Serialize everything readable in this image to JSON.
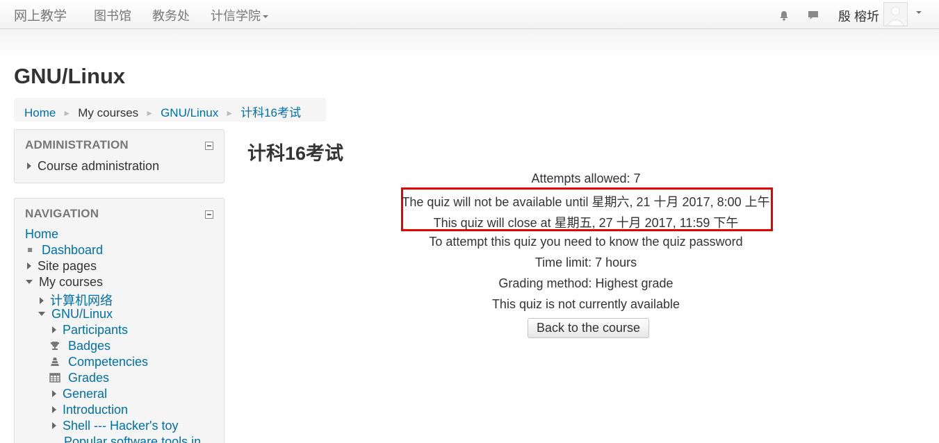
{
  "navbar": {
    "brand": "网上教学",
    "links": [
      "图书馆",
      "教务处",
      "计信学院"
    ],
    "icons": [
      "bell-icon",
      "chat-icon"
    ],
    "user_name": "殷 榕圻"
  },
  "page_title": "GNU/Linux",
  "breadcrumb": [
    "Home",
    "My courses",
    "GNU/Linux",
    "计科16考试"
  ],
  "administration": {
    "title": "ADMINISTRATION",
    "items": [
      "Course administration"
    ]
  },
  "navigation": {
    "title": "NAVIGATION",
    "home": "Home",
    "dashboard": "Dashboard",
    "site_pages": "Site pages",
    "my_courses": "My courses",
    "course_network": "计算机网络",
    "course_linux": "GNU/Linux",
    "participants": "Participants",
    "badges": "Badges",
    "competencies": "Competencies",
    "grades": "Grades",
    "general": "General",
    "introduction": "Introduction",
    "shell": "Shell --- Hacker's toy",
    "popular": "Popular software tools in"
  },
  "quiz": {
    "title": "计科16考试",
    "attempts": "Attempts allowed: 7",
    "open_msg": "The quiz will not be available until 星期六, 21 十月 2017, 8:00 上午",
    "close_msg": "This quiz will close at 星期五, 27 十月 2017, 11:59 下午",
    "password_msg": "To attempt this quiz you need to know the quiz password",
    "time_limit": "Time limit: 7 hours",
    "grading": "Grading method: Highest grade",
    "unavailable": "This quiz is not currently available",
    "back_button": "Back to the course"
  },
  "colors": {
    "link": "#0070a8",
    "highlight": "#e60000"
  }
}
